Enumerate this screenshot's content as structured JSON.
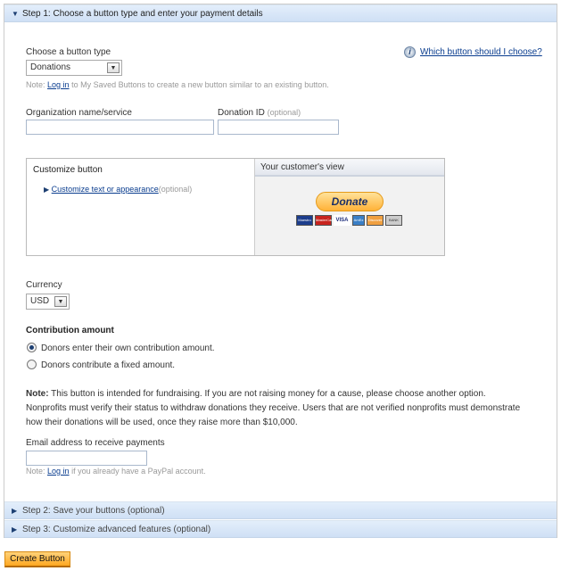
{
  "steps": [
    {
      "label": "Step 1: Choose a button type and enter your payment details",
      "expanded": true
    },
    {
      "label": "Step 2: Save your buttons (optional)",
      "expanded": false
    },
    {
      "label": "Step 3: Customize advanced features (optional)",
      "expanded": false
    }
  ],
  "button_type": {
    "label": "Choose a button type",
    "value": "Donations",
    "help_link": "Which button should I choose?",
    "note_prefix": "Note:",
    "note_link": "Log in",
    "note_suffix": "to My Saved Buttons to create a new button similar to an existing button."
  },
  "org": {
    "label": "Organization name/service",
    "value": ""
  },
  "donation_id": {
    "label": "Donation ID",
    "optional": "(optional)",
    "value": ""
  },
  "customize": {
    "title": "Customize button",
    "link": "Customize text or appearance",
    "optional": "(optional)",
    "preview_title": "Your customer's view",
    "donate_label": "Donate",
    "cards": [
      "Maestro",
      "MasterCard",
      "VISA",
      "AmEx",
      "Discover",
      "BANK"
    ]
  },
  "currency": {
    "label": "Currency",
    "value": "USD"
  },
  "contribution": {
    "label": "Contribution amount",
    "options": [
      {
        "label": "Donors enter their own contribution amount.",
        "selected": true
      },
      {
        "label": "Donors contribute a fixed amount.",
        "selected": false
      }
    ]
  },
  "fund_note": {
    "bold": "Note:",
    "text": " This button is intended for fundraising. If you are not raising money for a cause, please choose another option. Nonprofits must verify their status to withdraw donations they receive. Users that are not verified nonprofits must demonstrate how their donations will be used, once they raise more than $10,000."
  },
  "email": {
    "label": "Email address to receive payments",
    "value": "",
    "note_prefix": "Note:",
    "note_link": "Log in",
    "note_suffix": "if you already have a PayPal account."
  },
  "create_button": "Create Button",
  "colors": {
    "accent": "#ffa822",
    "link": "#0a3d8f",
    "header_bg": "#d6e5f7"
  }
}
